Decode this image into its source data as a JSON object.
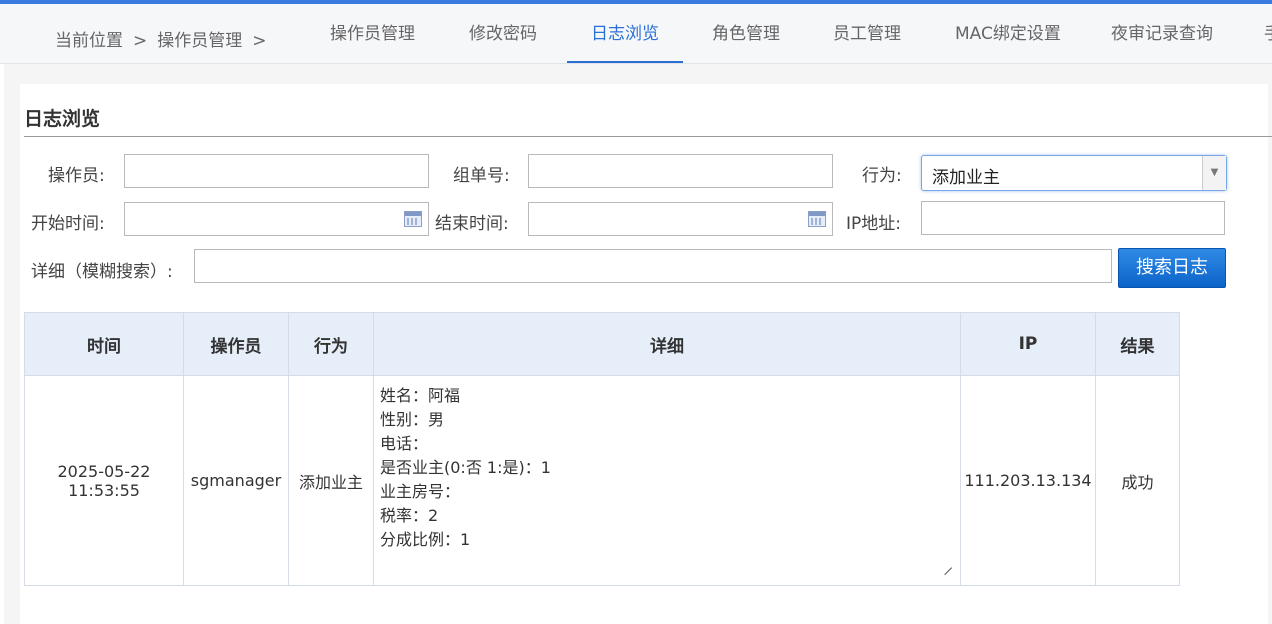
{
  "breadcrumb": {
    "prefix": "当前位置",
    "sep": ">",
    "current": "操作员管理",
    "sep2": ">"
  },
  "tabs": [
    {
      "label": "操作员管理"
    },
    {
      "label": "修改密码"
    },
    {
      "label": "日志浏览"
    },
    {
      "label": "角色管理"
    },
    {
      "label": "员工管理"
    },
    {
      "label": "MAC绑定设置"
    },
    {
      "label": "夜审记录查询"
    },
    {
      "label": "手"
    }
  ],
  "active_tab": "日志浏览",
  "section_title": "日志浏览",
  "form": {
    "operator_label": "操作员:",
    "order_label": "组单号:",
    "action_label": "行为:",
    "action_value": "添加业主",
    "start_label": "开始时间:",
    "end_label": "结束时间:",
    "ip_label": "IP地址:",
    "detail_label": "详细（模糊搜索）:",
    "search_button": "搜索日志"
  },
  "table": {
    "headers": [
      "时间",
      "操作员",
      "行为",
      "详细",
      "IP",
      "结果"
    ],
    "rows": [
      {
        "time_date": "2025-05-22",
        "time_clock": "11:53:55",
        "operator": "sgmanager",
        "action": "添加业主",
        "detail_lines": [
          "姓名：阿福",
          "性别：男",
          "电话：",
          "是否业主(0:否 1:是)：1",
          "业主房号：",
          "税率：2",
          "分成比例：1"
        ],
        "ip": "111.203.13.134",
        "result": "成功"
      }
    ]
  },
  "colors": {
    "accent": "#2a6fd6",
    "button": "#0b63c8",
    "header_bg": "#e5eef9"
  }
}
